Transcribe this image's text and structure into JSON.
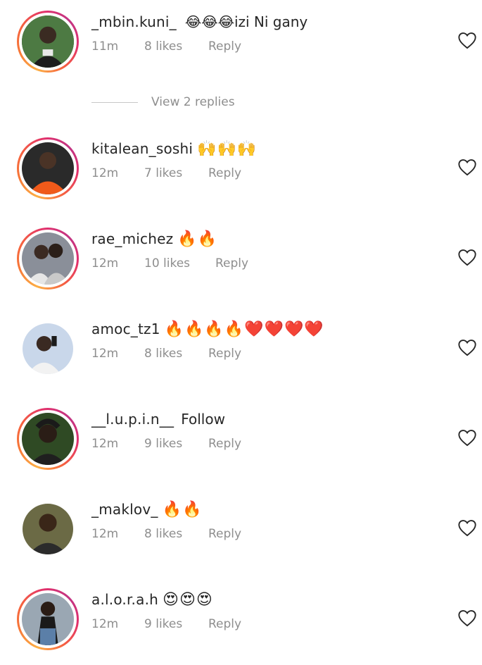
{
  "view_replies_label": "View 2 replies",
  "reply_label": "Reply",
  "colors": {
    "text_primary": "#262626",
    "text_secondary": "#8e8e8e",
    "story_ring_gradient": [
      "#fcaf45",
      "#f77737",
      "#e1306c",
      "#c13584"
    ]
  },
  "comments": [
    {
      "username": "_mbin.kuni_",
      "text": "😂😂😂izi Ni gany",
      "time": "11m",
      "likes": "8 likes",
      "story_ring": true,
      "avatar_icon": "user-avatar-icon"
    },
    {
      "username": "kitalean_soshi",
      "text": "🙌🙌🙌",
      "time": "12m",
      "likes": "7 likes",
      "story_ring": true,
      "avatar_icon": "user-avatar-icon"
    },
    {
      "username": "rae_michez",
      "text": "🔥🔥",
      "time": "12m",
      "likes": "10 likes",
      "story_ring": true,
      "avatar_icon": "user-avatar-icon"
    },
    {
      "username": "amoc_tz1",
      "text": "🔥🔥🔥🔥❤️❤️❤️❤️",
      "time": "12m",
      "likes": "8 likes",
      "story_ring": false,
      "avatar_icon": "user-avatar-icon"
    },
    {
      "username": "__l.u.p.i.n__",
      "text": "Follow",
      "time": "12m",
      "likes": "9 likes",
      "story_ring": true,
      "avatar_icon": "user-avatar-icon"
    },
    {
      "username": "_maklov_",
      "text": "🔥🔥",
      "time": "12m",
      "likes": "8 likes",
      "story_ring": false,
      "avatar_icon": "user-avatar-icon"
    },
    {
      "username": "a.l.o.r.a.h",
      "text": "😍😍😍",
      "time": "12m",
      "likes": "9 likes",
      "story_ring": true,
      "avatar_icon": "user-avatar-icon"
    }
  ]
}
